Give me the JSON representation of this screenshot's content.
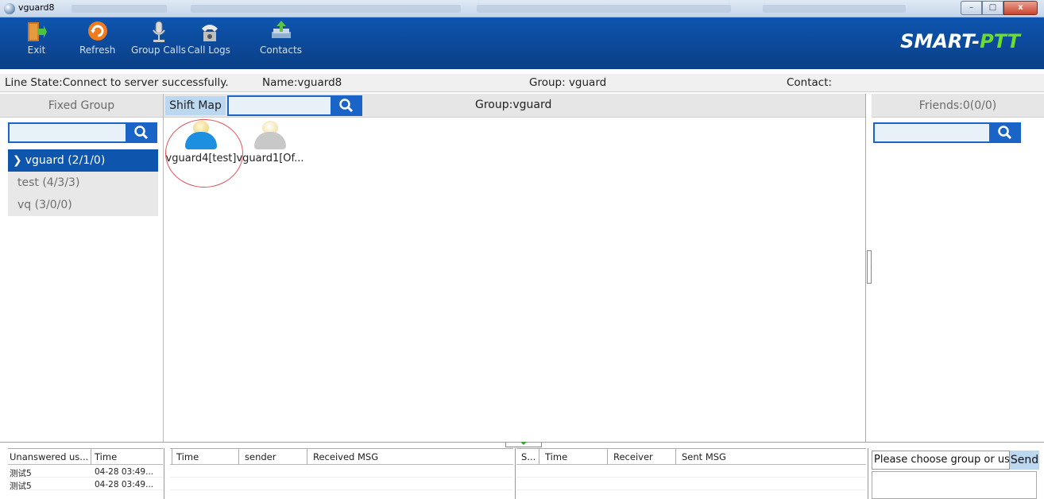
{
  "window": {
    "title": "vguard8",
    "min": "–",
    "max": "□",
    "close": "x"
  },
  "toolbar": {
    "buttons": [
      {
        "label": "Exit"
      },
      {
        "label": "Refresh"
      },
      {
        "label": "Group Calls"
      },
      {
        "label": "Call Logs"
      },
      {
        "label": "Contacts"
      }
    ],
    "brand_smart": "SMART-",
    "brand_ptt": "PTT"
  },
  "status": {
    "line_state": "Line State:Connect to server successfully.",
    "name": "Name:vguard8",
    "group": "Group: vguard",
    "contact": "Contact:"
  },
  "left": {
    "header": "Fixed Group",
    "search_value": "",
    "groups": [
      {
        "label": "vguard (2/1/0)",
        "active": true
      },
      {
        "label": "test (4/3/3)",
        "active": false
      },
      {
        "label": "vq (3/0/0)",
        "active": false
      }
    ]
  },
  "center": {
    "shift_map": "Shift Map",
    "search_value": "",
    "group_title": "Group:vguard",
    "users": [
      {
        "label": "vguard4[test]",
        "status": "online",
        "color": "#1c8fe0"
      },
      {
        "label": "vguard1[Of...",
        "status": "offline",
        "color": "#c8c8c8"
      }
    ]
  },
  "right": {
    "header": "Friends:0(0/0)",
    "search_value": ""
  },
  "bottom": {
    "unanswered": {
      "headers": [
        "Unanswered us...",
        "Time"
      ],
      "rows": [
        [
          "测试5",
          "04-28 03:49..."
        ],
        [
          "测试5",
          "04-28 03:49..."
        ]
      ]
    },
    "received": {
      "headers": [
        "Time",
        "sender",
        "Received MSG"
      ]
    },
    "sent": {
      "headers": [
        "S...",
        "Time",
        "Receiver",
        "Sent MSG"
      ]
    },
    "message_placeholder": "Please choose group or us",
    "send_label": "Send"
  },
  "colors": {
    "toolbar": "#0d4ea3",
    "accent": "#1a64c8",
    "active_group": "#0d55ad",
    "brand_ptt": "#6edc2a"
  }
}
